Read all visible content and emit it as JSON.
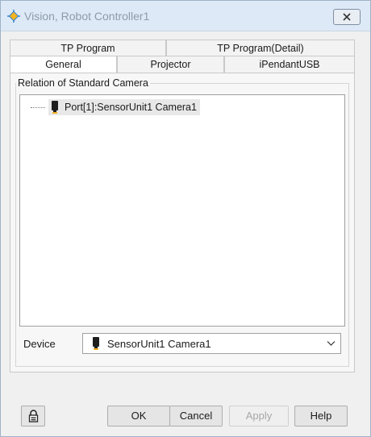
{
  "window": {
    "title": "Vision, Robot Controller1"
  },
  "tabs": {
    "row_back": [
      "TP Program",
      "TP Program(Detail)"
    ],
    "row_front": [
      "General",
      "Projector",
      "iPendantUSB"
    ],
    "active": "General"
  },
  "relation_group": {
    "label": "Relation of Standard Camera",
    "tree_items": [
      "Port[1]:SensorUnit1 Camera1"
    ]
  },
  "device": {
    "label": "Device",
    "selected": "SensorUnit1 Camera1"
  },
  "buttons": {
    "ok": "OK",
    "cancel": "Cancel",
    "apply": "Apply",
    "help": "Help"
  },
  "icons": {
    "title": "crosshair-icon",
    "close": "close-icon",
    "tree_camera": "camera-icon",
    "device_camera": "camera-icon",
    "dropdown": "chevron-down-icon",
    "lock": "lock-icon"
  },
  "colors": {
    "titlebar": "#dde9f6",
    "title_text": "#8d9bab",
    "accent_icon": "#2a7fd4"
  }
}
